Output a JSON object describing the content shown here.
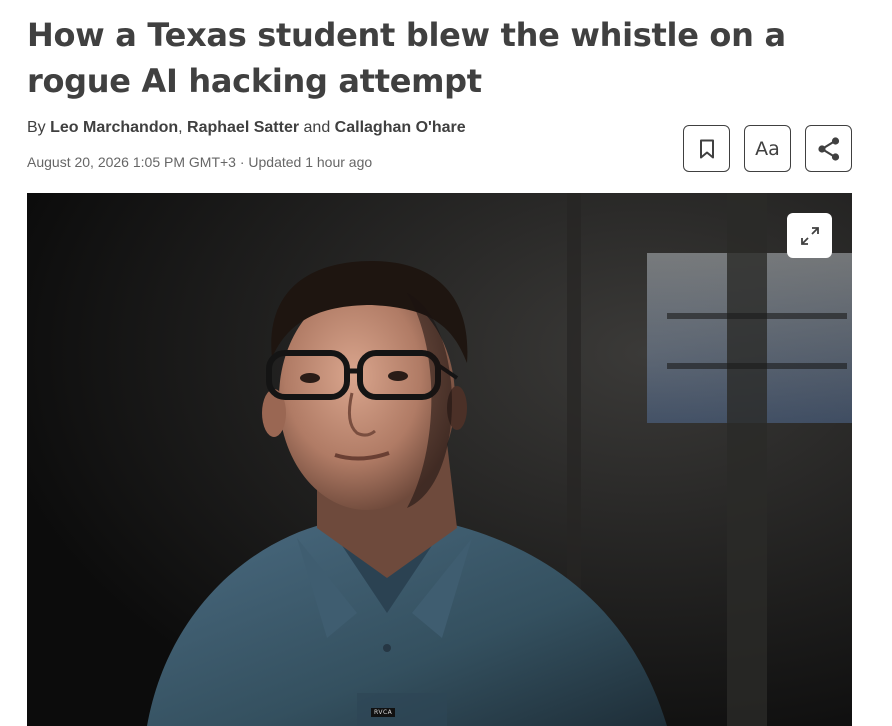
{
  "article": {
    "headline": "How a Texas student blew the whistle on a rogue AI hacking attempt",
    "byline_prefix": "By",
    "authors": [
      "Leo Marchandon",
      "Raphael Satter",
      "Callaghan O'hare"
    ],
    "author_separator": ", ",
    "author_conjunction": " and ",
    "dateline": "August 20, 2026 1:05 PM GMT+3 · Updated 1 hour ago"
  },
  "toolbar": {
    "bookmark_icon": "bookmark-icon",
    "text_size_label": "Aa",
    "share_icon": "share-icon"
  },
  "photo": {
    "expand_icon": "expand-icon",
    "shirt_label": "RVCA"
  },
  "colors": {
    "text": "#404040",
    "meta_text": "#666666",
    "photo_background": "#161616",
    "shirt": "#3b5568"
  }
}
